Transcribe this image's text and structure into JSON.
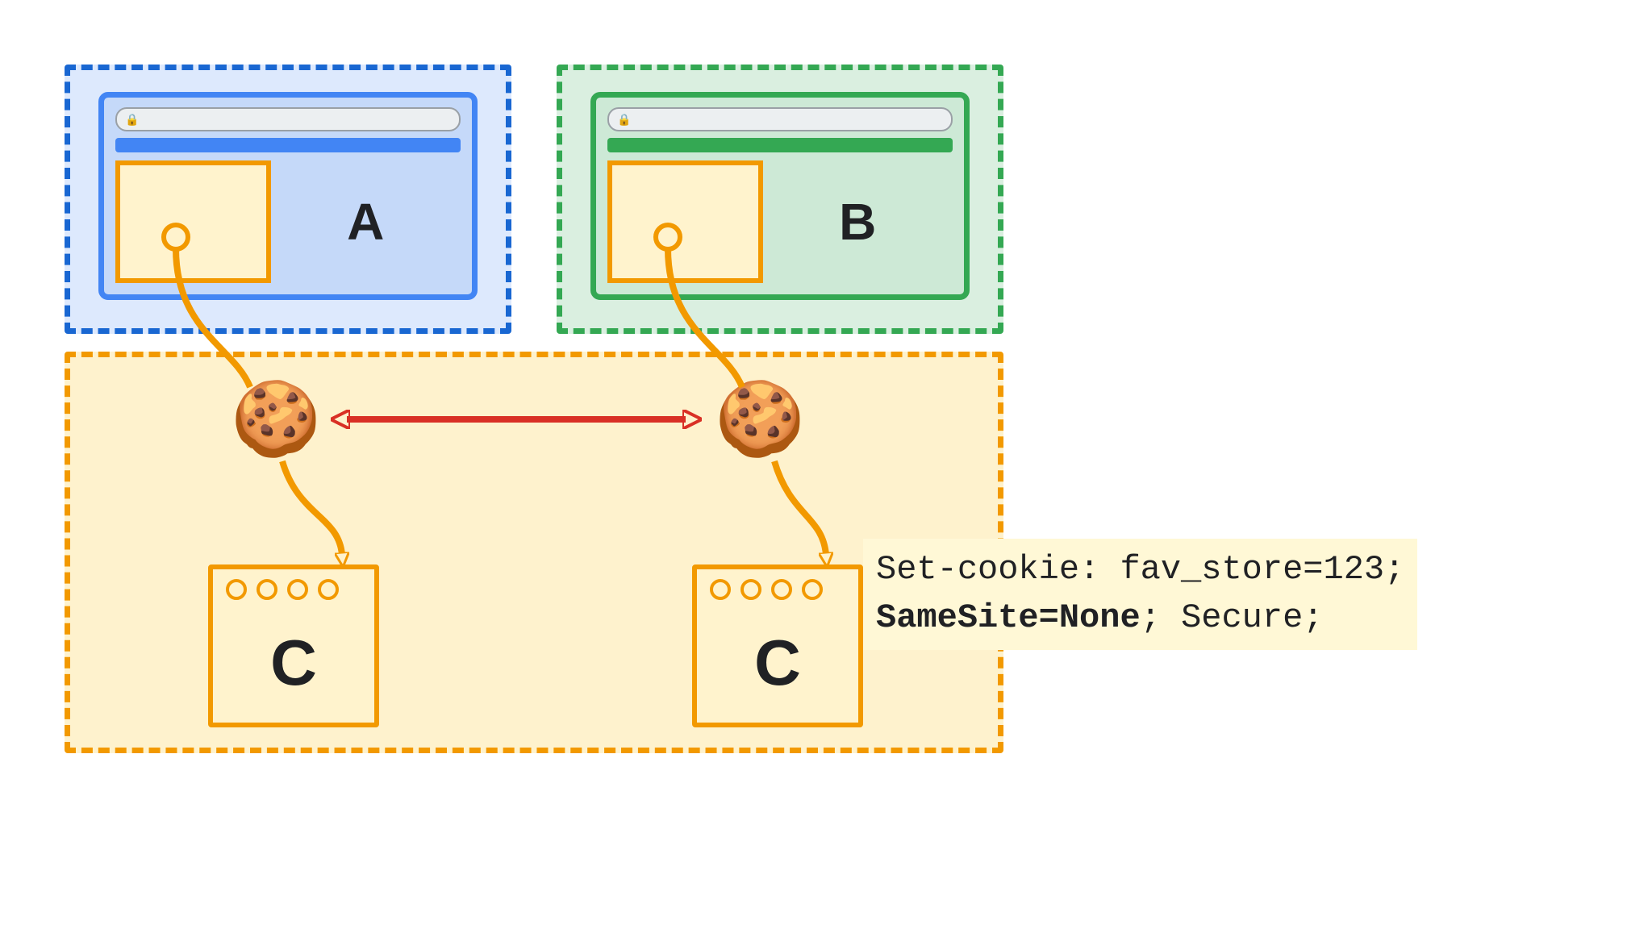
{
  "diagram": {
    "sites": {
      "a": {
        "label": "A"
      },
      "b": {
        "label": "B"
      },
      "c_left": {
        "label": "C"
      },
      "c_right": {
        "label": "C"
      }
    },
    "cookie_glyph": "🍪",
    "header": {
      "line1": "Set-cookie: fav_store=123;",
      "line2_bold": "SameSite=None",
      "line2_rest": "; Secure;"
    },
    "colors": {
      "site_a": "#1967d2",
      "site_b": "#34a853",
      "site_c": "#f29900",
      "arrow_red": "#d93025",
      "arrow_orange": "#f29900"
    }
  }
}
